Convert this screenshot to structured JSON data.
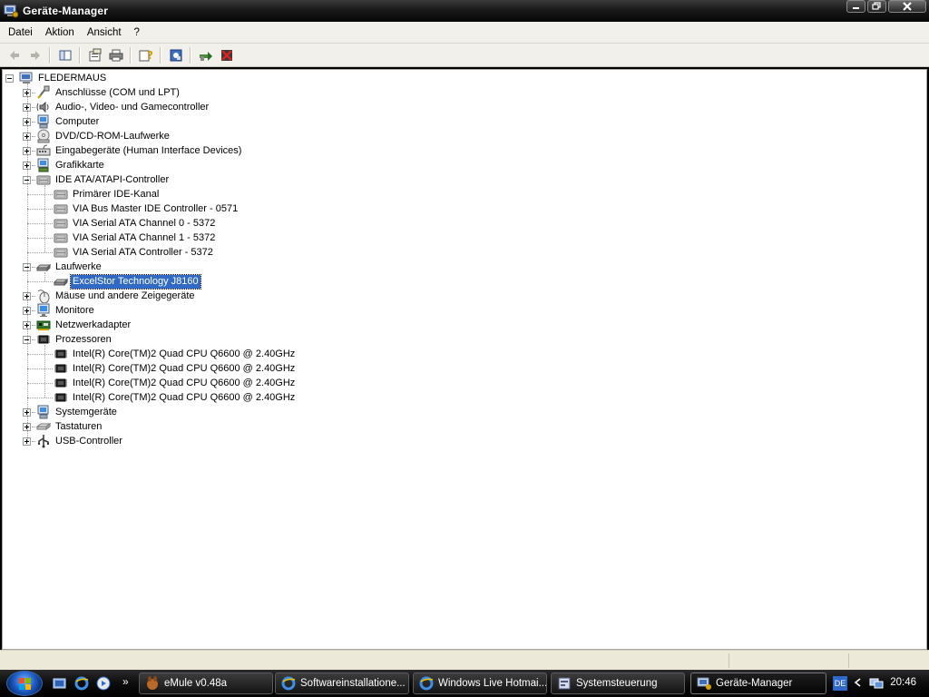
{
  "window": {
    "title": "Geräte-Manager"
  },
  "menubar": {
    "items": [
      "Datei",
      "Aktion",
      "Ansicht",
      "?"
    ]
  },
  "tree": {
    "root": "FLEDERMAUS",
    "categories": [
      {
        "label": "Anschlüsse (COM und LPT)",
        "icon": "port-icon",
        "expanded": false
      },
      {
        "label": "Audio-, Video- und Gamecontroller",
        "icon": "speaker-icon",
        "expanded": false
      },
      {
        "label": "Computer",
        "icon": "computer-icon",
        "expanded": false
      },
      {
        "label": "DVD/CD-ROM-Laufwerke",
        "icon": "cdrom-icon",
        "expanded": false
      },
      {
        "label": "Eingabegeräte (Human Interface Devices)",
        "icon": "hid-icon",
        "expanded": false
      },
      {
        "label": "Grafikkarte",
        "icon": "display-adapter-icon",
        "expanded": false
      },
      {
        "label": "IDE ATA/ATAPI-Controller",
        "icon": "ide-controller-icon",
        "expanded": true,
        "children": [
          "Primärer IDE-Kanal",
          "VIA Bus Master IDE Controller - 0571",
          "VIA Serial ATA Channel 0 - 5372",
          "VIA Serial ATA Channel 1 - 5372",
          "VIA Serial ATA Controller - 5372"
        ]
      },
      {
        "label": "Laufwerke",
        "icon": "disk-drive-icon",
        "expanded": true,
        "children": [
          "ExcelStor Technology J8160"
        ]
      },
      {
        "label": "Mäuse und andere Zeigegeräte",
        "icon": "mouse-icon",
        "expanded": false
      },
      {
        "label": "Monitore",
        "icon": "monitor-icon",
        "expanded": false
      },
      {
        "label": "Netzwerkadapter",
        "icon": "network-card-icon",
        "expanded": false
      },
      {
        "label": "Prozessoren",
        "icon": "cpu-icon",
        "expanded": true,
        "children": [
          "Intel(R) Core(TM)2 Quad CPU    Q6600  @ 2.40GHz",
          "Intel(R) Core(TM)2 Quad CPU    Q6600  @ 2.40GHz",
          "Intel(R) Core(TM)2 Quad CPU    Q6600  @ 2.40GHz",
          "Intel(R) Core(TM)2 Quad CPU    Q6600  @ 2.40GHz"
        ]
      },
      {
        "label": "Systemgeräte",
        "icon": "system-device-icon",
        "expanded": false
      },
      {
        "label": "Tastaturen",
        "icon": "keyboard-icon",
        "expanded": false
      },
      {
        "label": "USB-Controller",
        "icon": "usb-icon",
        "expanded": false
      }
    ],
    "selected": "ExcelStor Technology J8160"
  },
  "taskbar": {
    "buttons": [
      {
        "label": "eMule v0.48a",
        "icon": "emule-icon"
      },
      {
        "label": "Softwareinstallatione...",
        "icon": "ie-icon"
      },
      {
        "label": "Windows Live Hotmai...",
        "icon": "ie-icon"
      },
      {
        "label": "Systemsteuerung",
        "icon": "control-panel-icon"
      },
      {
        "label": "Geräte-Manager",
        "icon": "device-manager-icon"
      }
    ],
    "language": "DE",
    "clock": "20:46",
    "chevron": "»"
  },
  "colors": {
    "selection": "#316ac5",
    "window_bg": "#ffffff",
    "chrome": "#f1f0ea"
  }
}
